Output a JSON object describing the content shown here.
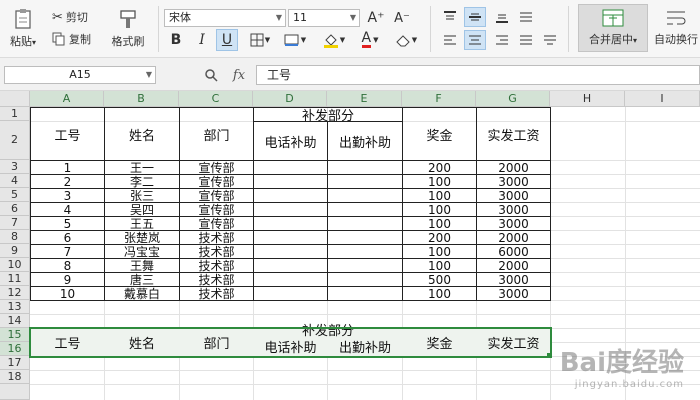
{
  "ribbon": {
    "paste": "粘贴",
    "paste_arrow": "▾",
    "cut": "剪切",
    "copy": "复制",
    "format_painter": "格式刷",
    "font_name": "宋体",
    "font_size": "11",
    "grow_font": "A⁺",
    "shrink_font": "A⁻",
    "bold": "B",
    "italic": "I",
    "underline": "U",
    "font_color_letter": "A",
    "merge_center": "合并居中",
    "merge_arrow": "▾",
    "auto_wrap": "自动换行"
  },
  "formula_bar": {
    "name_box": "A15",
    "fx": "fx",
    "content": "工号"
  },
  "columns": [
    "A",
    "B",
    "C",
    "D",
    "E",
    "F",
    "G",
    "H",
    "I"
  ],
  "rows": [
    "1",
    "2",
    "3",
    "4",
    "5",
    "6",
    "7",
    "8",
    "9",
    "10",
    "11",
    "12",
    "13",
    "14",
    "15",
    "16",
    "17",
    "18"
  ],
  "table1": {
    "headers": {
      "id": "工号",
      "name": "姓名",
      "dept": "部门",
      "allowance": "补发部分",
      "phone": "电话补助",
      "travel": "出勤补助",
      "bonus": "奖金",
      "pay": "实发工资"
    },
    "rows": [
      [
        "1",
        "王一",
        "宣传部",
        "",
        "",
        "200",
        "2000"
      ],
      [
        "2",
        "李二",
        "宣传部",
        "",
        "",
        "100",
        "3000"
      ],
      [
        "3",
        "张三",
        "宣传部",
        "",
        "",
        "100",
        "3000"
      ],
      [
        "4",
        "吴四",
        "宣传部",
        "",
        "",
        "100",
        "3000"
      ],
      [
        "5",
        "王五",
        "宣传部",
        "",
        "",
        "100",
        "3000"
      ],
      [
        "6",
        "张楚岚",
        "技术部",
        "",
        "",
        "200",
        "2000"
      ],
      [
        "7",
        "冯宝宝",
        "技术部",
        "",
        "",
        "100",
        "6000"
      ],
      [
        "8",
        "王舞",
        "技术部",
        "",
        "",
        "100",
        "2000"
      ],
      [
        "9",
        "唐三",
        "技术部",
        "",
        "",
        "500",
        "3000"
      ],
      [
        "10",
        "戴慕白",
        "技术部",
        "",
        "",
        "100",
        "3000"
      ]
    ]
  },
  "table2": {
    "id": "工号",
    "name": "姓名",
    "dept": "部门",
    "allowance": "补发部分",
    "phone": "电话补助",
    "travel": "出勤补助",
    "bonus": "奖金",
    "pay": "实发工资"
  },
  "watermark": {
    "main": "Bai度经验",
    "sub": "jingyan.baidu.com"
  },
  "colors": {
    "selection": "#2e8b3d",
    "header_bg": "#e6e6e6",
    "selected_header_bg": "#d3e2d5"
  }
}
